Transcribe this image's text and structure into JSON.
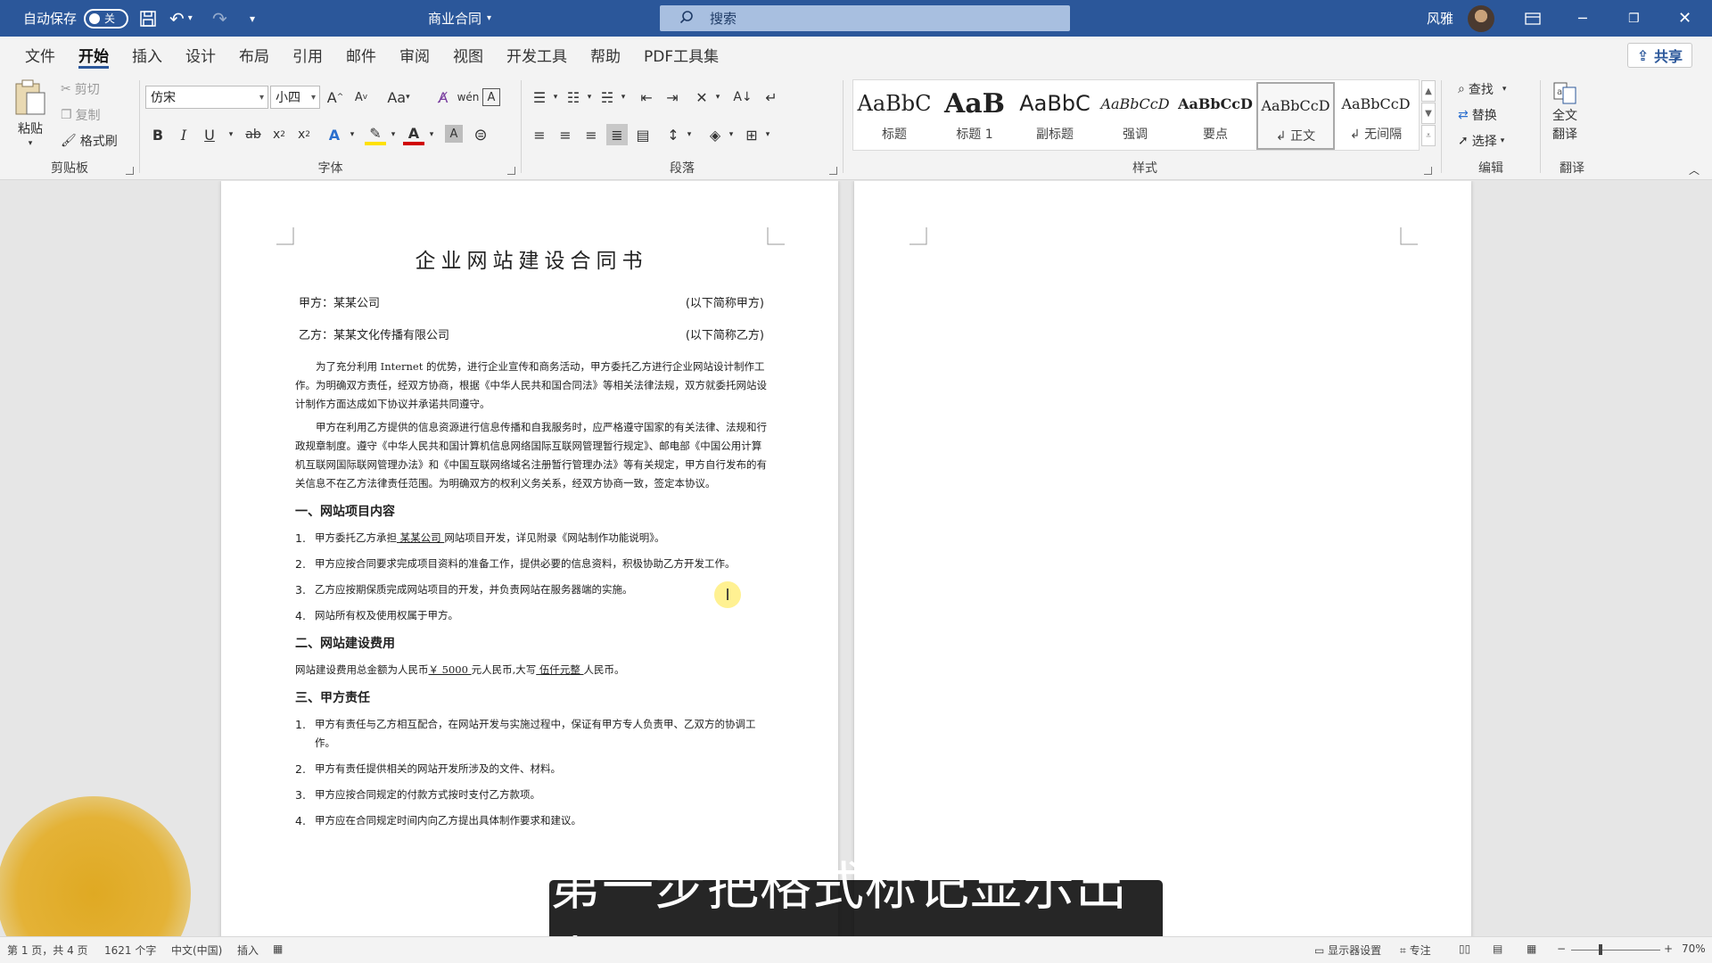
{
  "titlebar": {
    "autosave_label": "自动保存",
    "autosave_state": "关",
    "doc_name": "商业合同",
    "search_placeholder": "搜索",
    "user_name": "风雅"
  },
  "menu": {
    "tabs": [
      "文件",
      "开始",
      "插入",
      "设计",
      "布局",
      "引用",
      "邮件",
      "审阅",
      "视图",
      "开发工具",
      "帮助",
      "PDF工具集"
    ],
    "share": "共享"
  },
  "ribbon": {
    "clipboard": {
      "paste": "粘贴",
      "cut": "剪切",
      "copy": "复制",
      "format_painter": "格式刷",
      "label": "剪贴板"
    },
    "font": {
      "font_name": "仿宋",
      "font_size": "小四",
      "label": "字体"
    },
    "paragraph": {
      "label": "段落"
    },
    "styles": {
      "label": "样式",
      "items": [
        {
          "preview": "AaBbC",
          "name": "标题"
        },
        {
          "preview": "AaB",
          "name": "标题 1"
        },
        {
          "preview": "AaBbC",
          "name": "副标题"
        },
        {
          "preview": "AaBbCcD",
          "name": "强调"
        },
        {
          "preview": "AaBbCcD",
          "name": "要点"
        },
        {
          "preview": "AaBbCcD",
          "name": "↲ 正文"
        },
        {
          "preview": "AaBbCcD",
          "name": "↲ 无间隔"
        }
      ]
    },
    "editing": {
      "find": "查找",
      "replace": "替换",
      "select": "选择",
      "label": "编辑"
    },
    "translate": {
      "btn_line1": "全文",
      "btn_line2": "翻译",
      "label": "翻译"
    }
  },
  "doc": {
    "title": "企业网站建设合同书",
    "party_a": "甲方：某某公司",
    "party_a_note": "(以下简称甲方)",
    "party_b": "乙方：某某文化传播有限公司",
    "party_b_note": "(以下简称乙方)",
    "para1": "为了充分利用 Internet 的优势，进行企业宣传和商务活动，甲方委托乙方进行企业网站设计制作工作。为明确双方责任，经双方协商，根据《中华人民共和国合同法》等相关法律法规，双方就委托网站设计制作方面达成如下协议并承诺共同遵守。",
    "para2": "甲方在利用乙方提供的信息资源进行信息传播和自我服务时，应严格遵守国家的有关法律、法规和行政规章制度。遵守《中华人民共和国计算机信息网络国际互联网管理暂行规定》、邮电部《中国公用计算机互联网国际联网管理办法》和《中国互联网络域名注册暂行管理办法》等有关规定，甲方自行发布的有关信息不在乙方法律责任范围。为明确双方的权利义务关系，经双方协商一致，签定本协议。",
    "sec1": "一、网站项目内容",
    "items1": [
      {
        "num": "1.",
        "pre": "甲方委托乙方承担",
        "u": " 某某公司 ",
        "post": "网站项目开发，详见附录《网站制作功能说明》。"
      },
      {
        "num": "2.",
        "pre": "甲方应按合同要求完成项目资料的准备工作，提供必要的信息资料，积极协助乙方开发工作。",
        "u": "",
        "post": ""
      },
      {
        "num": "3.",
        "pre": "乙方应按期保质完成网站项目的开发，并负责网站在服务器端的实施。",
        "u": "",
        "post": ""
      },
      {
        "num": "4.",
        "pre": "网站所有权及使用权属于甲方。",
        "u": "",
        "post": ""
      }
    ],
    "sec2": "二、网站建设费用",
    "fee_pre": "网站建设费用总金额为人民币",
    "fee_amount": "￥ 5000 ",
    "fee_mid": "元人民币,大写",
    "fee_caps": " 伍仟元整 ",
    "fee_post": "人民币。",
    "sec3": "三、甲方责任",
    "items3": [
      {
        "num": "1.",
        "text": "甲方有责任与乙方相互配合，在网站开发与实施过程中，保证有甲方专人负责甲、乙双方的协调工作。"
      },
      {
        "num": "2.",
        "text": "甲方有责任提供相关的网站开发所涉及的文件、材料。"
      },
      {
        "num": "3.",
        "text": "甲方应按合同规定的付款方式按时支付乙方款项。"
      },
      {
        "num": "4.",
        "text": "甲方应在合同规定时间内向乙方提出具体制作要求和建议。"
      }
    ]
  },
  "subtitle": "第一步把格式标记显示出来",
  "status": {
    "page": "第 1 页，共 4 页",
    "words": "1621 个字",
    "lang": "中文(中国)",
    "mode": "插入",
    "display_settings": "显示器设置",
    "focus": "专注",
    "zoom": "70%"
  },
  "colors": {
    "accent": "#2b579a",
    "ribbon_bg": "#f3f3f3",
    "canvas_bg": "#e6e6e6"
  }
}
